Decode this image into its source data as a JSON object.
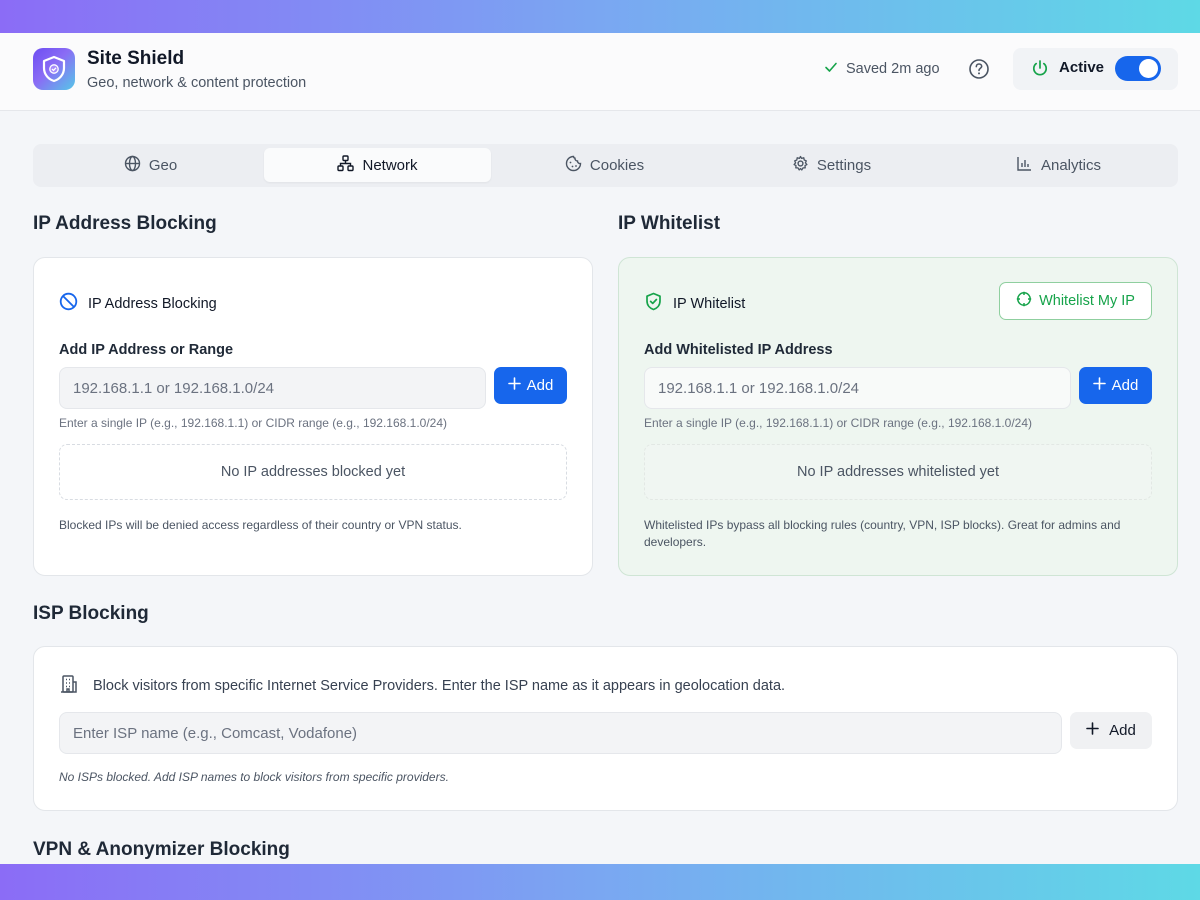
{
  "app": {
    "title": "Site Shield",
    "subtitle": "Geo, network & content protection",
    "saved_status": "Saved 2m ago",
    "active_label": "Active",
    "active_on": true
  },
  "tabs": [
    {
      "label": "Geo",
      "icon": "globe-icon",
      "active": false
    },
    {
      "label": "Network",
      "icon": "network-icon",
      "active": true
    },
    {
      "label": "Cookies",
      "icon": "cookie-icon",
      "active": false
    },
    {
      "label": "Settings",
      "icon": "gear-icon",
      "active": false
    },
    {
      "label": "Analytics",
      "icon": "bar-chart-icon",
      "active": false
    }
  ],
  "ip_blocking": {
    "section_title": "IP Address Blocking",
    "card_title": "IP Address Blocking",
    "field_label": "Add IP Address or Range",
    "placeholder": "192.168.1.1 or 192.168.1.0/24",
    "add_label": "Add",
    "hint": "Enter a single IP (e.g., 192.168.1.1) or CIDR range (e.g., 192.168.1.0/24)",
    "empty": "No IP addresses blocked yet",
    "footnote": "Blocked IPs will be denied access regardless of their country or VPN status."
  },
  "ip_whitelist": {
    "section_title": "IP Whitelist",
    "card_title": "IP Whitelist",
    "whitelist_my_ip": "Whitelist My IP",
    "field_label": "Add Whitelisted IP Address",
    "placeholder": "192.168.1.1 or 192.168.1.0/24",
    "add_label": "Add",
    "hint": "Enter a single IP (e.g., 192.168.1.1) or CIDR range (e.g., 192.168.1.0/24)",
    "empty": "No IP addresses whitelisted yet",
    "footnote": "Whitelisted IPs bypass all blocking rules (country, VPN, ISP blocks). Great for admins and developers."
  },
  "isp_blocking": {
    "section_title": "ISP Blocking",
    "description": "Block visitors from specific Internet Service Providers. Enter the ISP name as it appears in geolocation data.",
    "placeholder": "Enter ISP name (e.g., Comcast, Vodafone)",
    "add_label": "Add",
    "note": "No ISPs blocked. Add ISP names to block visitors from specific providers."
  },
  "vpn_blocking": {
    "section_title": "VPN & Anonymizer Blocking"
  },
  "colors": {
    "accent": "#1766ec",
    "success": "#16a34a",
    "gradient_start": "#8b6cf6",
    "gradient_end": "#5ed9e6"
  }
}
